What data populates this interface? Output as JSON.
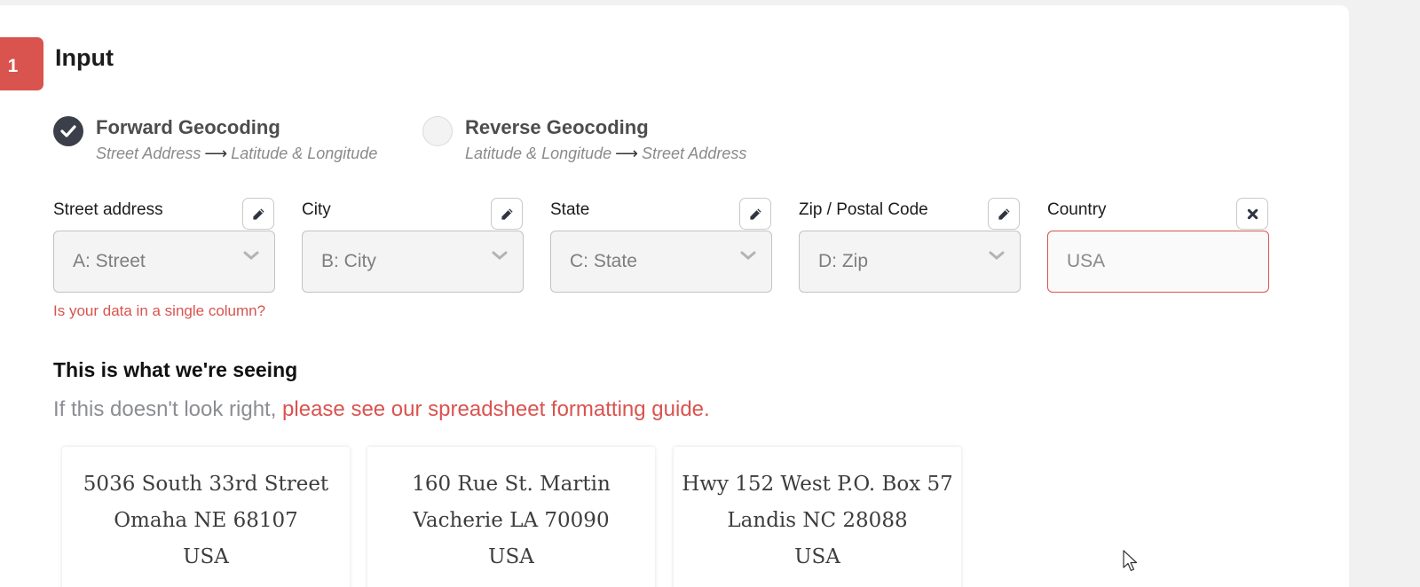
{
  "step": {
    "number": "1",
    "title": "Input"
  },
  "modes": [
    {
      "label": "Forward Geocoding",
      "from": "Street Address",
      "to": "Latitude & Longitude",
      "selected": true
    },
    {
      "label": "Reverse Geocoding",
      "from": "Latitude & Longitude",
      "to": "Street Address",
      "selected": false
    }
  ],
  "fields": [
    {
      "label": "Street address",
      "value": "A: Street",
      "button_icon": "pencil-icon"
    },
    {
      "label": "City",
      "value": "B: City",
      "button_icon": "pencil-icon"
    },
    {
      "label": "State",
      "value": "C: State",
      "button_icon": "pencil-icon"
    },
    {
      "label": "Zip / Postal Code",
      "value": "D: Zip",
      "button_icon": "pencil-icon"
    },
    {
      "label": "Country",
      "value": "USA",
      "button_icon": "close-icon"
    }
  ],
  "single_column_prompt": "Is your data in a single column?",
  "preview": {
    "title": "This is what we're seeing",
    "subtitle_prefix": "If this doesn't look right, ",
    "subtitle_link": "please see our spreadsheet formatting guide.",
    "cards": [
      {
        "line1": "5036 South 33rd Street",
        "line2": "Omaha NE 68107",
        "line3": "USA"
      },
      {
        "line1": "160 Rue St. Martin",
        "line2": "Vacherie LA 70090",
        "line3": "USA"
      },
      {
        "line1": "Hwy 152 West P.O. Box 57",
        "line2": "Landis NC 28088",
        "line3": "USA"
      }
    ]
  },
  "colors": {
    "accent": "#d9534f",
    "radio_checked": "#3a3f4a",
    "background": "#f1f1f2"
  }
}
